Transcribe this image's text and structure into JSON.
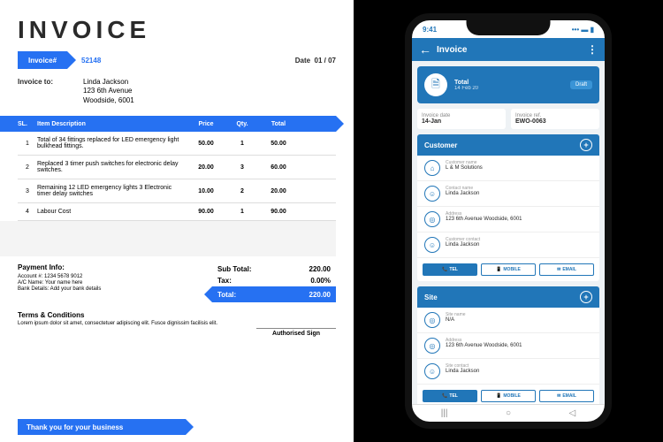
{
  "doc": {
    "title": "INVOICE",
    "invoice_label": "Invoice#",
    "invoice_no": "52148",
    "date_label": "Date",
    "date": "01 / 07",
    "to_label": "Invoice to:",
    "to_name": "Linda Jackson",
    "to_street": "123 6th Avenue",
    "to_city": "Woodside, 6001",
    "cols": {
      "sl": "SL.",
      "desc": "Item Description",
      "price": "Price",
      "qty": "Qty.",
      "total": "Total"
    },
    "rows": [
      {
        "sl": "1",
        "desc": "Total of 34 fittings replaced for LED emergency light bulkhead fittings.",
        "price": "50.00",
        "qty": "1",
        "total": "50.00"
      },
      {
        "sl": "2",
        "desc": "Replaced 3 timer push switches for electronic delay switches.",
        "price": "20.00",
        "qty": "3",
        "total": "60.00"
      },
      {
        "sl": "3",
        "desc": "Remaining 12 LED emergency lights 3 Electronic timer delay switches",
        "price": "10.00",
        "qty": "2",
        "total": "20.00"
      },
      {
        "sl": "4",
        "desc": "Labour Cost",
        "price": "90.00",
        "qty": "1",
        "total": "90.00"
      }
    ],
    "subtotal_label": "Sub Total:",
    "subtotal": "220.00",
    "tax_label": "Tax:",
    "tax": "0.00%",
    "total_label": "Total:",
    "total": "220.00",
    "pay_title": "Payment Info:",
    "pay_acct": "Account #:   1234 5678 9012",
    "pay_name": "A/C Name:   Your name here",
    "pay_bank": "Bank Details:   Add your bank details",
    "terms_title": "Terms & Conditions",
    "terms_body": "Lorem ipsum dolor sit amet, consectetuer adipiscing elit. Fusce dignissim facilisis elit.",
    "sign": "Authorised Sign",
    "thanks": "Thank you for your business"
  },
  "phone": {
    "time": "9:41",
    "title": "Invoice",
    "hero_label": "Total",
    "hero_amt": "14 Feb 20",
    "hero_badge": "Draft",
    "invdate_lbl": "Invoice date",
    "invdate": "14-Jan",
    "invref_lbl": "Invoice ref.",
    "invref": "EWO-0063",
    "cust_title": "Customer",
    "cust_name_lbl": "Customer name",
    "cust_name": "L & M Solutions",
    "contact_lbl": "Contact name",
    "contact": "Linda Jackson",
    "addr_lbl": "Address",
    "addr": "123 6th Avenue Woodside, 6001",
    "custcontact_lbl": "Customer contact",
    "custcontact": "Linda Jackson",
    "btn_tel": "TEL",
    "btn_mob": "MOBILE",
    "btn_email": "EMAIL",
    "site_title": "Site",
    "site_name_lbl": "Site name",
    "site_name": "N/A",
    "site_addr": "123 6th Avenue Woodside, 6001",
    "site_contact_lbl": "Site contact",
    "site_contact": "Linda Jackson"
  }
}
